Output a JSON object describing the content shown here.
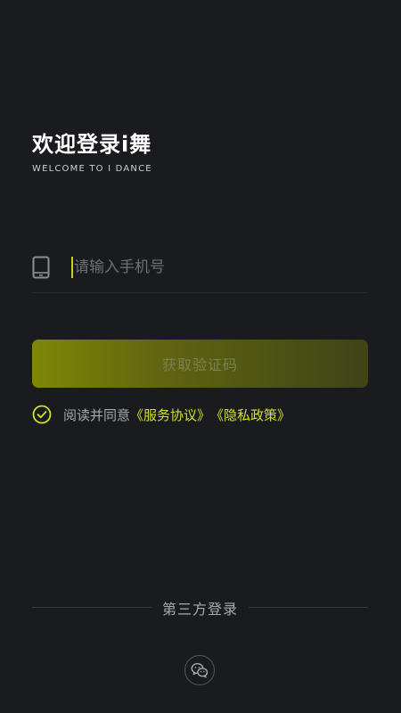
{
  "header": {
    "title": "欢迎登录i舞",
    "subtitle": "WELCOME TO I DANCE"
  },
  "phone_field": {
    "icon": "phone-icon",
    "placeholder": "请输入手机号",
    "value": ""
  },
  "code_button": {
    "label": "获取验证码"
  },
  "agreement": {
    "checked": true,
    "text": "阅读并同意",
    "service_link": "《服务协议》",
    "privacy_link": "《隐私政策》"
  },
  "third_party": {
    "label": "第三方登录",
    "providers": [
      "wechat-icon"
    ]
  },
  "colors": {
    "background": "#1a1b1f",
    "accent": "#d3e02b",
    "button_gradient_start": "#7f8706",
    "button_gradient_end": "#3f4316"
  }
}
